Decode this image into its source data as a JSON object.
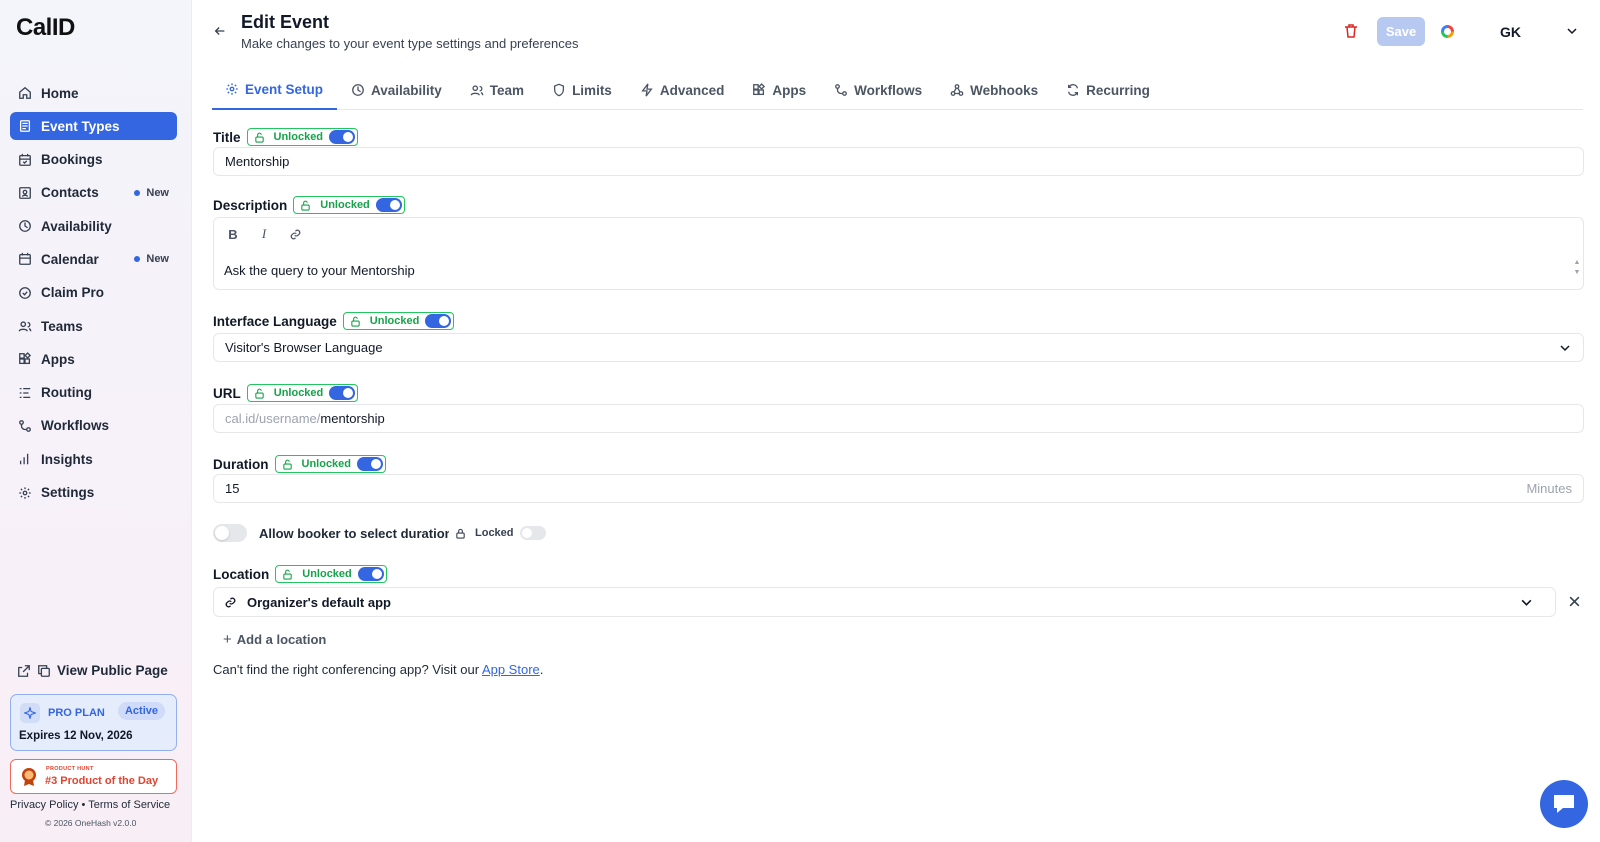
{
  "brand": {
    "logo": "CalID"
  },
  "sidebar": {
    "items": [
      {
        "label": "Home",
        "icon": "home-icon"
      },
      {
        "label": "Event Types",
        "icon": "event-types-icon",
        "active": true
      },
      {
        "label": "Bookings",
        "icon": "calendar-check-icon"
      },
      {
        "label": "Contacts",
        "icon": "contacts-icon",
        "badge": "New"
      },
      {
        "label": "Availability",
        "icon": "clock-icon"
      },
      {
        "label": "Calendar",
        "icon": "calendar-icon",
        "badge": "New"
      },
      {
        "label": "Claim Pro",
        "icon": "badge-icon"
      },
      {
        "label": "Teams",
        "icon": "users-icon"
      },
      {
        "label": "Apps",
        "icon": "grid-icon"
      },
      {
        "label": "Routing",
        "icon": "routing-icon"
      },
      {
        "label": "Workflows",
        "icon": "workflow-icon"
      },
      {
        "label": "Insights",
        "icon": "bar-chart-icon"
      },
      {
        "label": "Settings",
        "icon": "gear-icon"
      }
    ],
    "view_public_page": "View Public Page",
    "plan": {
      "title": "PRO PLAN",
      "status": "Active",
      "expires": "Expires 12 Nov, 2026"
    },
    "product_hunt": {
      "small": "PRODUCT HUNT",
      "big": "#3 Product of the Day"
    },
    "footer": {
      "privacy": "Privacy Policy",
      "sep": "•",
      "terms": "Terms of Service",
      "copyright": "© 2026 OneHash v2.0.0"
    }
  },
  "header": {
    "title": "Edit Event",
    "subtitle": "Make changes to your event type settings and preferences",
    "save_label": "Save",
    "user_initials": "GK"
  },
  "tabs": [
    {
      "label": "Event Setup",
      "icon": "gear-icon",
      "active": true
    },
    {
      "label": "Availability",
      "icon": "clock-icon"
    },
    {
      "label": "Team",
      "icon": "users-icon"
    },
    {
      "label": "Limits",
      "icon": "shield-icon"
    },
    {
      "label": "Advanced",
      "icon": "bolt-icon"
    },
    {
      "label": "Apps",
      "icon": "grid-icon"
    },
    {
      "label": "Workflows",
      "icon": "workflow-icon"
    },
    {
      "label": "Webhooks",
      "icon": "webhook-icon"
    },
    {
      "label": "Recurring",
      "icon": "refresh-icon"
    }
  ],
  "form": {
    "unlocked_label": "Unlocked",
    "locked_label": "Locked",
    "title": {
      "label": "Title",
      "value": "Mentorship"
    },
    "description": {
      "label": "Description",
      "value": "Ask the query to your Mentorship",
      "tools": [
        "B",
        "I"
      ]
    },
    "language": {
      "label": "Interface Language",
      "value": "Visitor's Browser Language"
    },
    "url": {
      "label": "URL",
      "prefix": "cal.id/username/",
      "value": "mentorship"
    },
    "duration": {
      "label": "Duration",
      "value": "15",
      "suffix": "Minutes"
    },
    "booker_duration": {
      "label": "Allow booker to select duration",
      "enabled": false
    },
    "location": {
      "label": "Location",
      "value": "Organizer's default app",
      "add_label": "Add a location"
    },
    "conferencing": {
      "text": "Can't find the right conferencing app? Visit our",
      "link": "App Store",
      "end": "."
    }
  },
  "colors": {
    "accent": "#3366e0",
    "unlocked": "#16a34a",
    "danger": "#e0432f"
  }
}
